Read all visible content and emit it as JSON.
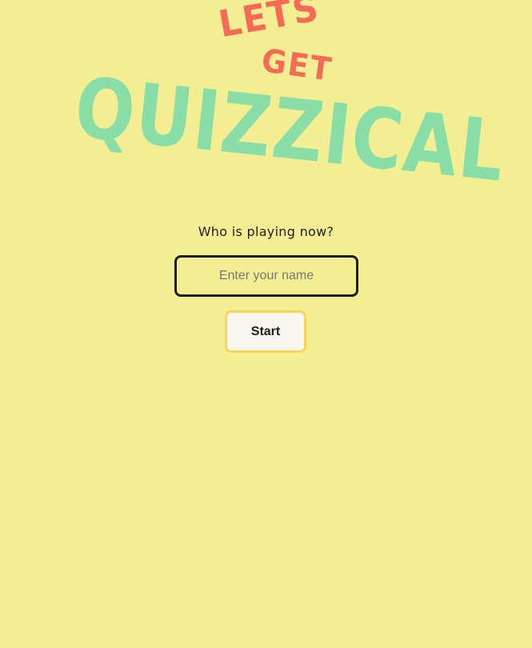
{
  "logo": {
    "line1": "LETS",
    "line2": "GET",
    "line3": "QUIZZICAL"
  },
  "form": {
    "prompt": "Who is playing now?",
    "name_placeholder": "Enter your name",
    "name_value": "",
    "start_label": "Start"
  },
  "colors": {
    "background": "#f3ee94",
    "logo_accent": "#f46a55",
    "logo_main": "#88dea6",
    "input_border": "#1d1d1d",
    "button_border": "#f8d553",
    "button_background": "#faf7f3"
  }
}
